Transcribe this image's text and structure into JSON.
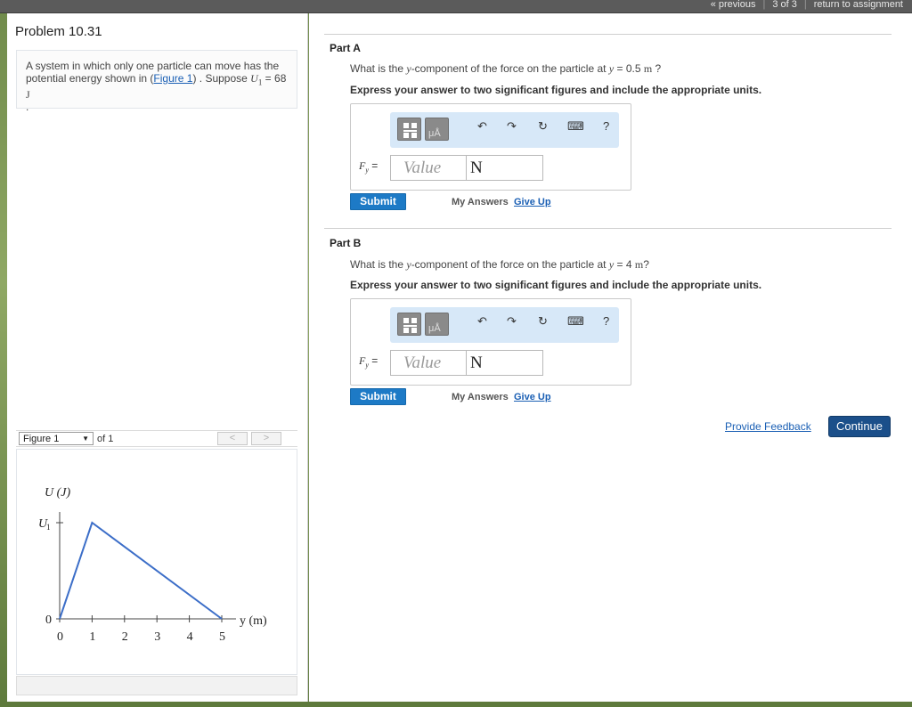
{
  "nav": {
    "previous": "« previous",
    "position": "3 of 3",
    "return": "return to assignment"
  },
  "problem": {
    "title": "Problem 10.31",
    "intro_pre": "A system in which only one particle can move has the potential energy shown in (",
    "figure_link": "Figure 1",
    "intro_mid": ") . Suppose ",
    "u_symbol": "U",
    "u_sub": "1",
    "intro_eq": " = 68 ",
    "intro_unit": "J",
    "intro_end": "."
  },
  "figure": {
    "selector": "Figure 1",
    "of": "of 1",
    "prev": "<",
    "next": ">"
  },
  "chart_data": {
    "type": "line",
    "title": "",
    "ylabel": "U (J)",
    "xlabel": "y (m)",
    "x": [
      0,
      1,
      5
    ],
    "y": [
      0,
      68,
      0
    ],
    "x_ticks": [
      "0",
      "1",
      "2",
      "3",
      "4",
      "5"
    ],
    "y_ticks": [
      "0",
      "U1"
    ],
    "xlim": [
      0,
      5
    ],
    "ylim": [
      0,
      68
    ],
    "grid": false,
    "color": "#3c6ec8"
  },
  "parts": [
    {
      "label": "Part A",
      "q_pre": "What is the ",
      "q_var": "y",
      "q_mid": "-component of the force on the particle at ",
      "q_y": "y",
      "q_eq": " = 0.5 ",
      "q_unit": "m",
      "q_end": " ?",
      "instruction": "Express your answer to two significant figures and include the appropriate units.",
      "fy": "F",
      "fy_sub": "y",
      "fy_eq": " =",
      "value_placeholder": "Value",
      "unit": "N",
      "submit": "Submit",
      "my_answers": "My Answers",
      "give_up": "Give Up"
    },
    {
      "label": "Part B",
      "q_pre": "What is the ",
      "q_var": "y",
      "q_mid": "-component of the force on the particle at ",
      "q_y": "y",
      "q_eq": " = 4 ",
      "q_unit": "m",
      "q_end": "?",
      "instruction": "Express your answer to two significant figures and include the appropriate units.",
      "fy": "F",
      "fy_sub": "y",
      "fy_eq": " =",
      "value_placeholder": "Value",
      "unit": "N",
      "submit": "Submit",
      "my_answers": "My Answers",
      "give_up": "Give Up"
    }
  ],
  "toolbar": {
    "mu_label": "μÅ",
    "undo": "↶",
    "redo": "↷",
    "reset": "↻",
    "keyboard": "⌨",
    "help": "?"
  },
  "footer": {
    "feedback": "Provide Feedback",
    "continue": "Continue"
  }
}
